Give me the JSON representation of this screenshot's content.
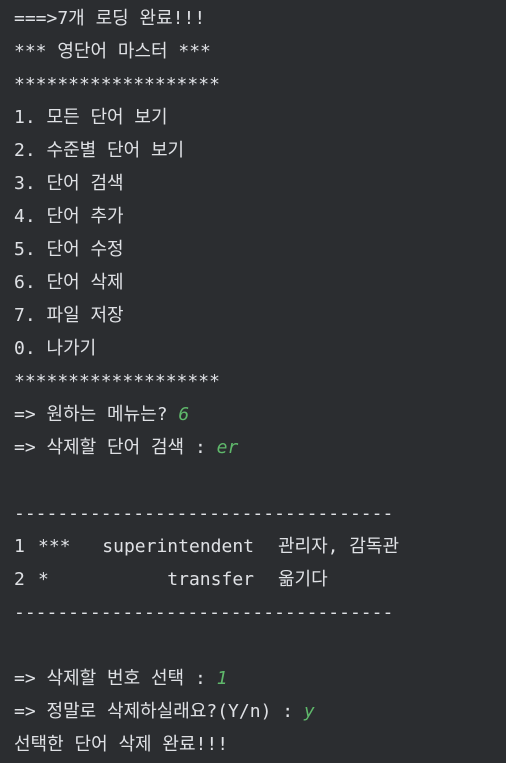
{
  "console": {
    "load_message": "===>7개 로딩 완료!!!",
    "title": "*** 영단어 마스터 ***",
    "divider_stars": "*******************",
    "menu_items": [
      "1. 모든 단어 보기",
      "2. 수준별 단어 보기",
      "3. 단어 검색",
      "4. 단어 추가",
      "5. 단어 수정",
      "6. 단어 삭제",
      "7. 파일 저장",
      "0. 나가기"
    ],
    "menu_prompt": "=> 원하는 메뉴는? ",
    "menu_input": "6",
    "search_prompt": "=> 삭제할 단어 검색 : ",
    "search_input": "er",
    "dash_divider": "-----------------------------------",
    "results": [
      {
        "num": "1",
        "level": "***",
        "word": "superintendent",
        "meaning": "관리자, 감독관"
      },
      {
        "num": "2",
        "level": "*",
        "word": "transfer",
        "meaning": "옮기다"
      }
    ],
    "delete_num_prompt": "=> 삭제할 번호 선택 : ",
    "delete_num_input": "1",
    "confirm_prompt": "=> 정말로 삭제하실래요?(Y/n) : ",
    "confirm_input": "y",
    "done_message": "선택한 단어 삭제 완료!!!"
  },
  "colors": {
    "background": "#2b2d30",
    "text": "#dfe1e5",
    "user_input": "#5fb86b"
  }
}
